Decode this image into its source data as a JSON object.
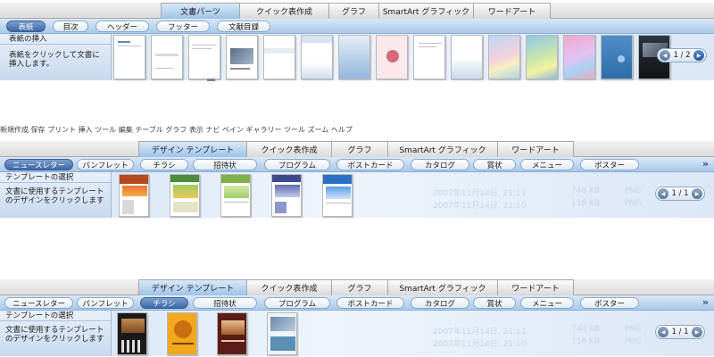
{
  "panel1": {
    "tabs": [
      "文書パーツ",
      "クイック表作成",
      "グラフ",
      "SmartArt グラフィック",
      "ワードアート"
    ],
    "categories": [
      "表紙",
      "目次",
      "ヘッダー",
      "フッター",
      "文献目録"
    ],
    "header": "表紙の挿入",
    "description": "表紙をクリックして文書に挿入します。",
    "pager": "1 / 2"
  },
  "stray_text": "新規作成  保存  プリント    挿入                          ツール                                      編集  テーブル  グラフ    表示  ナビ   ペイン   ギャラリー   ツール     ズーム   ヘルプ",
  "panel2": {
    "tabs": [
      "デザイン テンプレート",
      "クイック表作成",
      "グラフ",
      "SmartArt グラフィック",
      "ワードアート"
    ],
    "categories": [
      "ニュースレター",
      "パンフレット",
      "チラシ",
      "招待状",
      "プログラム",
      "ポストカード",
      "カタログ",
      "賞状",
      "メニュー",
      "ポスター"
    ],
    "header": "テンプレートの選択",
    "description": "文書に使用するテンプレートのデザインをクリックします",
    "pager": "1 / 1",
    "bg_rows": [
      "2007年11月14日, 21:11",
      "2007年11月14日, 21:10"
    ],
    "bg_sizes": [
      "748 KB",
      "116 KB"
    ],
    "bg_kinds": [
      "PNG",
      "PNG"
    ]
  },
  "panel3": {
    "tabs": [
      "デザイン テンプレート",
      "クイック表作成",
      "グラフ",
      "SmartArt グラフィック",
      "ワードアート"
    ],
    "categories": [
      "ニュースレター",
      "パンフレット",
      "チラシ",
      "招待状",
      "プログラム",
      "ポストカード",
      "カタログ",
      "賞状",
      "メニュー",
      "ポスター"
    ],
    "header": "テンプレートの選択",
    "description": "文書に使用するテンプレートのデザインをクリックします",
    "pager": "1 / 1",
    "bg_rows": [
      "2007年11月14日, 21:11",
      "2007年11月14日, 21:10"
    ],
    "bg_sizes": [
      "748 KB",
      "116 KB"
    ],
    "bg_kinds": [
      "PNG",
      "PNG"
    ]
  },
  "icons": {
    "chevron": "double-chevron-right-icon",
    "prev": "triangle-left-icon",
    "next": "triangle-right-icon"
  },
  "colors": {
    "accent": "#3c67a7",
    "bar": "#a9c8e8",
    "active_tab": "#9fc3e7"
  }
}
